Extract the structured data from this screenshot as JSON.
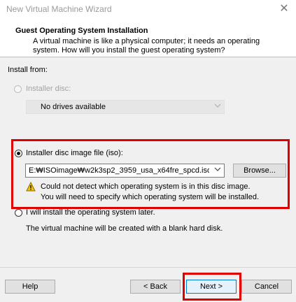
{
  "window": {
    "title": "New Virtual Machine Wizard",
    "close_glyph": "✕"
  },
  "header": {
    "title": "Guest Operating System Installation",
    "description": "A virtual machine is like a physical computer; it needs an operating system. How will you install the guest operating system?"
  },
  "install_from": {
    "label": "Install from:",
    "installer_disc": {
      "label": "Installer disc:",
      "selected": false,
      "enabled": false,
      "dropdown_value": "No drives available"
    },
    "iso": {
      "label": "Installer disc image file (iso):",
      "selected": true,
      "path": "E:₩ISOimage₩w2k3sp2_3959_usa_x64fre_spcd.iso",
      "browse_label": "Browse...",
      "warning_line1": "Could not detect which operating system is in this disc image.",
      "warning_line2": "You will need to specify which operating system will be installed."
    },
    "later": {
      "label": "I will install the operating system later.",
      "selected": false,
      "description": "The virtual machine will be created with a blank hard disk."
    }
  },
  "buttons": {
    "help": "Help",
    "back": "< Back",
    "next": "Next >",
    "cancel": "Cancel"
  },
  "colors": {
    "highlight": "#e00000",
    "warning_fill": "#f5c400"
  },
  "icons": {
    "dropdown": "chevron-down-icon",
    "warning": "warning-icon",
    "close": "close-icon"
  }
}
